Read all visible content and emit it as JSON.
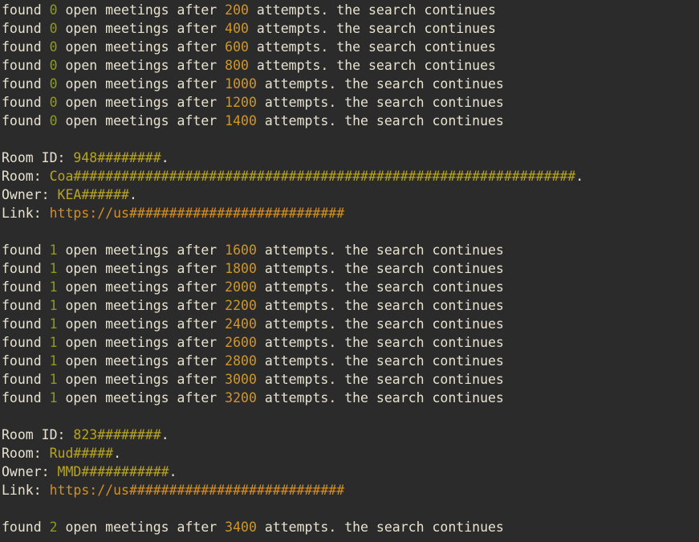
{
  "terminal": {
    "background_color": "#2b2b2b",
    "text_color": "#e8e2cf",
    "count_color": "#8f9a1e",
    "number_color": "#cf9626",
    "value_color": "#b8a51c",
    "link_color": "#d4901e"
  },
  "lines": [
    {
      "kind": "progress",
      "prefix": "found ",
      "count": "0",
      "middle": " open meetings after ",
      "attempts": "200",
      "suffix": " attempts. the search continues"
    },
    {
      "kind": "progress",
      "prefix": "found ",
      "count": "0",
      "middle": " open meetings after ",
      "attempts": "400",
      "suffix": " attempts. the search continues"
    },
    {
      "kind": "progress",
      "prefix": "found ",
      "count": "0",
      "middle": " open meetings after ",
      "attempts": "600",
      "suffix": " attempts. the search continues"
    },
    {
      "kind": "progress",
      "prefix": "found ",
      "count": "0",
      "middle": " open meetings after ",
      "attempts": "800",
      "suffix": " attempts. the search continues"
    },
    {
      "kind": "progress",
      "prefix": "found ",
      "count": "0",
      "middle": " open meetings after ",
      "attempts": "1000",
      "suffix": " attempts. the search continues"
    },
    {
      "kind": "progress",
      "prefix": "found ",
      "count": "0",
      "middle": " open meetings after ",
      "attempts": "1200",
      "suffix": " attempts. the search continues"
    },
    {
      "kind": "progress",
      "prefix": "found ",
      "count": "0",
      "middle": " open meetings after ",
      "attempts": "1400",
      "suffix": " attempts. the search continues"
    },
    {
      "kind": "blank"
    },
    {
      "kind": "field",
      "label": "Room ID: ",
      "value": "948########",
      "trailer": ".",
      "value_style": "val"
    },
    {
      "kind": "field",
      "label": "Room: ",
      "value": "Coa###############################################################",
      "trailer": ".",
      "value_style": "val"
    },
    {
      "kind": "field",
      "label": "Owner: ",
      "value": "KEA######",
      "trailer": ".",
      "value_style": "val"
    },
    {
      "kind": "field",
      "label": "Link: ",
      "value": "https://us###########################",
      "trailer": "",
      "value_style": "link"
    },
    {
      "kind": "blank"
    },
    {
      "kind": "progress",
      "prefix": "found ",
      "count": "1",
      "middle": " open meetings after ",
      "attempts": "1600",
      "suffix": " attempts. the search continues"
    },
    {
      "kind": "progress",
      "prefix": "found ",
      "count": "1",
      "middle": " open meetings after ",
      "attempts": "1800",
      "suffix": " attempts. the search continues"
    },
    {
      "kind": "progress",
      "prefix": "found ",
      "count": "1",
      "middle": " open meetings after ",
      "attempts": "2000",
      "suffix": " attempts. the search continues"
    },
    {
      "kind": "progress",
      "prefix": "found ",
      "count": "1",
      "middle": " open meetings after ",
      "attempts": "2200",
      "suffix": " attempts. the search continues"
    },
    {
      "kind": "progress",
      "prefix": "found ",
      "count": "1",
      "middle": " open meetings after ",
      "attempts": "2400",
      "suffix": " attempts. the search continues"
    },
    {
      "kind": "progress",
      "prefix": "found ",
      "count": "1",
      "middle": " open meetings after ",
      "attempts": "2600",
      "suffix": " attempts. the search continues"
    },
    {
      "kind": "progress",
      "prefix": "found ",
      "count": "1",
      "middle": " open meetings after ",
      "attempts": "2800",
      "suffix": " attempts. the search continues"
    },
    {
      "kind": "progress",
      "prefix": "found ",
      "count": "1",
      "middle": " open meetings after ",
      "attempts": "3000",
      "suffix": " attempts. the search continues"
    },
    {
      "kind": "progress",
      "prefix": "found ",
      "count": "1",
      "middle": " open meetings after ",
      "attempts": "3200",
      "suffix": " attempts. the search continues"
    },
    {
      "kind": "blank"
    },
    {
      "kind": "field",
      "label": "Room ID: ",
      "value": "823########",
      "trailer": ".",
      "value_style": "val"
    },
    {
      "kind": "field",
      "label": "Room: ",
      "value": "Rud#####",
      "trailer": ".",
      "value_style": "val"
    },
    {
      "kind": "field",
      "label": "Owner: ",
      "value": "MMD###########",
      "trailer": ".",
      "value_style": "val"
    },
    {
      "kind": "field",
      "label": "Link: ",
      "value": "https://us###########################",
      "trailer": "",
      "value_style": "link"
    },
    {
      "kind": "blank"
    },
    {
      "kind": "progress",
      "prefix": "found ",
      "count": "2",
      "middle": " open meetings after ",
      "attempts": "3400",
      "suffix": " attempts. the search continues"
    }
  ]
}
